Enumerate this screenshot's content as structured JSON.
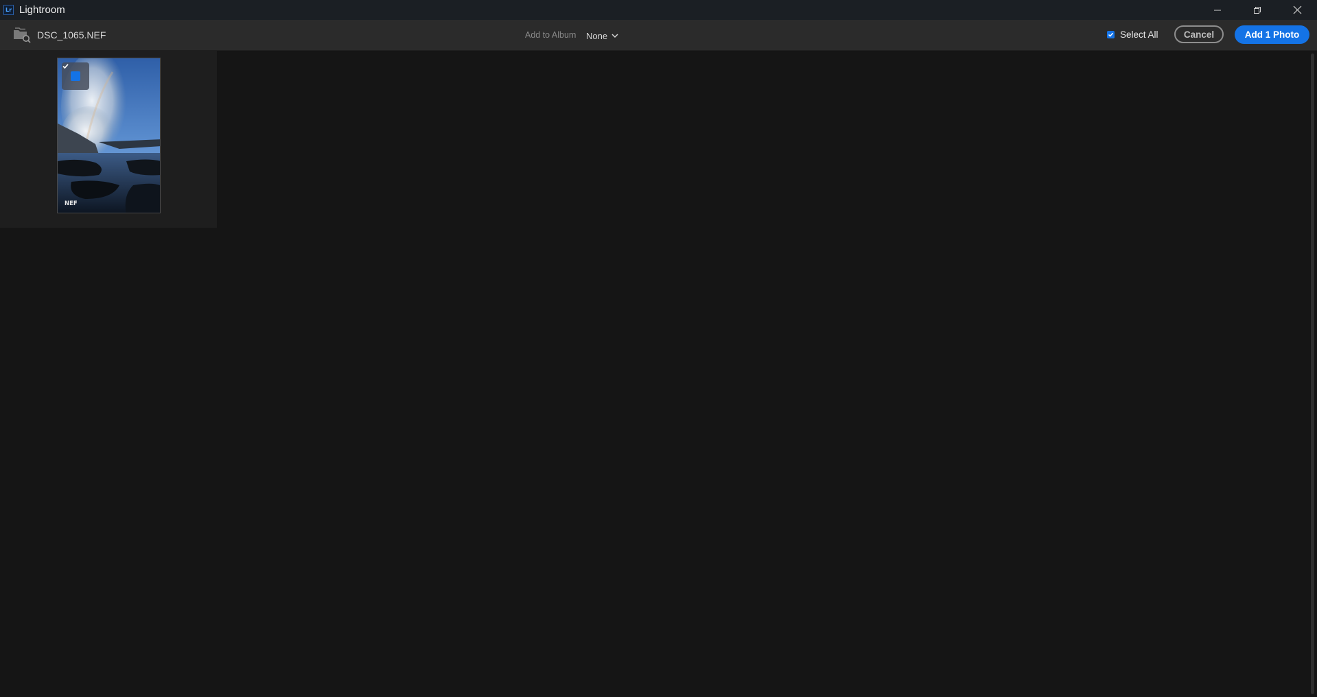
{
  "window": {
    "logo_text": "Lr",
    "title": "Lightroom",
    "controls": [
      "minimize-icon",
      "restore-icon",
      "close-icon"
    ]
  },
  "toolbar": {
    "file_name": "DSC_1065.NEF",
    "add_to_album_label": "Add to Album",
    "album_value": "None",
    "select_all_label": "Select All",
    "select_all_checked": true,
    "cancel_label": "Cancel",
    "add_label": "Add 1 Photo"
  },
  "photos": [
    {
      "format": "NEF",
      "selected": true
    }
  ],
  "colors": {
    "accent": "#1473e6",
    "background": "#151515",
    "toolbar": "#2b2b2b",
    "titlebar": "#1b1f24"
  }
}
